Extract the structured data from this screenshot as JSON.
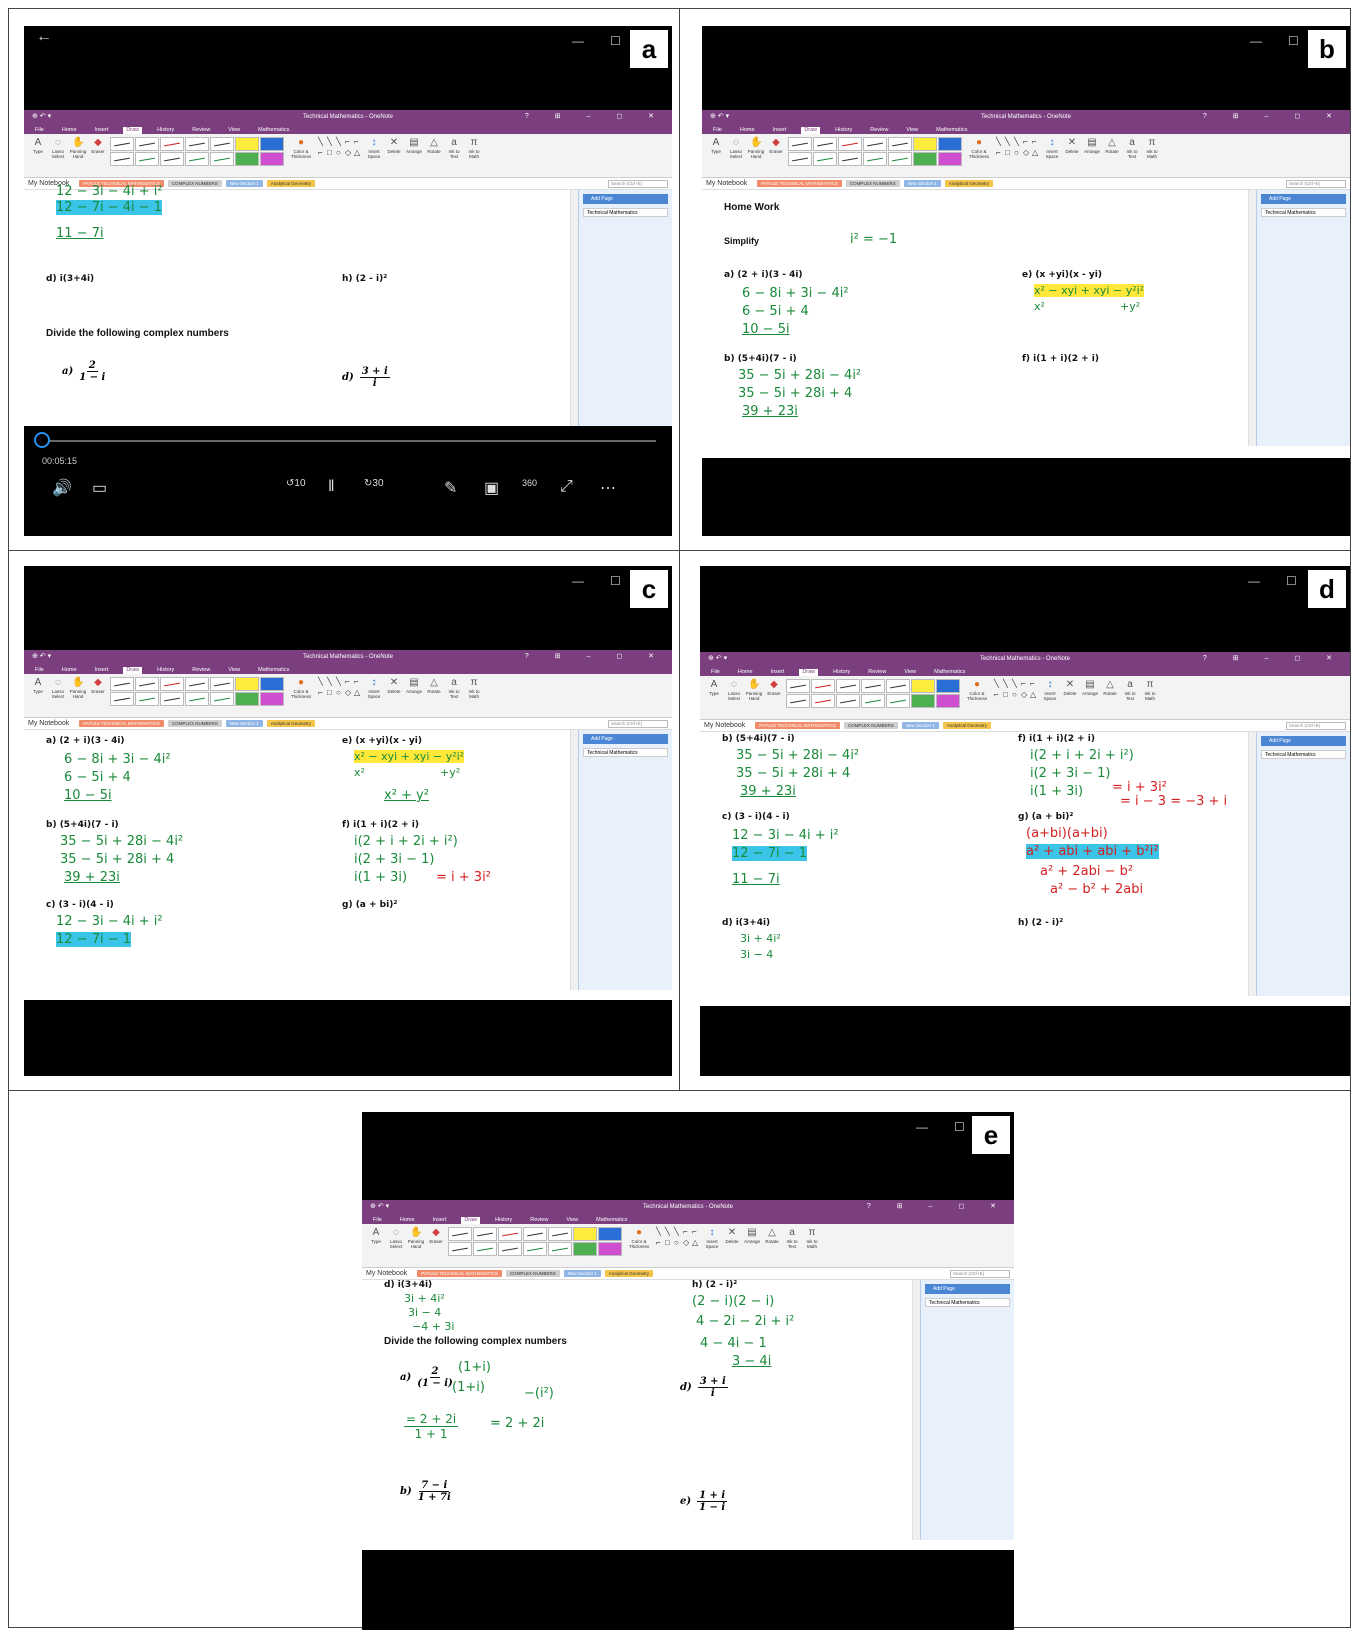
{
  "panels": [
    {
      "label": "a"
    },
    {
      "label": "b"
    },
    {
      "label": "c"
    },
    {
      "label": "d"
    },
    {
      "label": "e"
    }
  ],
  "app": {
    "title": "Technical Mathematics - OneNote",
    "menus": [
      "File",
      "Home",
      "Insert",
      "Draw",
      "History",
      "Review",
      "View",
      "Mathematics"
    ],
    "active_menu": "Draw",
    "ribbon_tools": [
      "Type",
      "Lasso Select",
      "Panning Hand",
      "Eraser"
    ],
    "ribbon_group_tools": "Tools",
    "ribbon_color": "Color & Thickness",
    "ribbon_group_shapes": "Shapes",
    "ribbon_edit": [
      "Insert Space",
      "Delete",
      "Arrange",
      "Rotate"
    ],
    "ribbon_group_edit": "Edit",
    "ribbon_convert": [
      "Ink to Text",
      "Ink to Math"
    ],
    "ribbon_group_convert": "Convert",
    "notebook": "My Notebook",
    "sections": [
      "PATULE TECHNICAL MATHEMATICS",
      "COMPLEX NUMBERS",
      "New Section 1",
      "Analytical Geometry"
    ],
    "search_placeholder": "Search (Ctrl+E)",
    "add_page": "Add Page",
    "page_name": "Technical Mathematics"
  },
  "video": {
    "time": "00:05:15",
    "skip_back": "10",
    "skip_fwd": "30",
    "vr": "360"
  },
  "a": {
    "ink1": "12 − 3i − 4i + i²",
    "ink2": "12 − 7i − 4i − 1",
    "ink3": "11 − 7i",
    "d": "d)  i(3+4i)",
    "h": "h)  (2 - i)²",
    "divide": "Divide the following complex numbers",
    "qa": "a)",
    "qa_num": "2",
    "qa_den": "1 − i",
    "qd": "d)",
    "qd_num": "3 + i",
    "qd_den": "i"
  },
  "b": {
    "title": "Home Work",
    "simplify": "Simplify",
    "i2": "i² = −1",
    "a": "a)  (2 + i)(3 - 4i)",
    "a1": "6 − 8i + 3i − 4i²",
    "a2": "6 − 5i + 4",
    "a3": "10 − 5i",
    "bq": "b)  (5+4i)(7 - i)",
    "b1": "35 − 5i + 28i − 4i²",
    "b2": "35 − 5i + 28i + 4",
    "b3": "39 + 23i",
    "e": "e)  (x +yi)(x - yi)",
    "e1": "x² − xyi + xyi − y²i²",
    "e2": "x²",
    "e3": "+y²",
    "f": "f)  i(1 + i)(2 + i)"
  },
  "c": {
    "a": "a)  (2 + i)(3 - 4i)",
    "a1": "6 − 8i + 3i − 4i²",
    "a2": "6 − 5i + 4",
    "a3": "10 − 5i",
    "bq": "b)  (5+4i)(7 - i)",
    "b1": "35 − 5i + 28i − 4i²",
    "b2": "35 − 5i + 28i + 4",
    "b3": "39 + 23i",
    "cq": "c)  (3 - i)(4 - i)",
    "c1": "12 − 3i − 4i + i²",
    "c2": "12 − 7i − 1",
    "e": "e)  (x +yi)(x - yi)",
    "e1": "x² − xyi + xyi − y²i²",
    "e2": "x²",
    "e3": "+y²",
    "e4": "x² + y²",
    "f": "f)  i(1 + i)(2 + i)",
    "f1": "i(2 + i + 2i + i²)",
    "f2": "i(2 + 3i − 1)",
    "f3": "i(1 + 3i)",
    "f4": "= i + 3i²",
    "g": "g)  (a + bi)²"
  },
  "d": {
    "bq": "b)  (5+4i)(7 - i)",
    "b1": "35 − 5i + 28i − 4i²",
    "b2": "35 − 5i + 28i + 4",
    "b3": "39 + 23i",
    "cq": "c)  (3 - i)(4 - i)",
    "c1": "12 − 3i − 4i + i²",
    "c2": "12 − 7i − 1",
    "c3": "11 − 7i",
    "dq": "d)  i(3+4i)",
    "d1": "3i + 4i²",
    "d2": "3i − 4",
    "f": "f)  i(1 + i)(2 + i)",
    "f1": "i(2 + i + 2i + i²)",
    "f2": "i(2 + 3i − 1)",
    "f3": "i(1 + 3i)",
    "f4": "= i + 3i²",
    "f5": "= i − 3 = −3 + i",
    "g": "g)  (a + bi)²",
    "g1": "(a+bi)(a+bi)",
    "g2": "a² + abi + abi + b²i²",
    "g3": "a² + 2abi − b²",
    "g4": "a² − b² + 2abi",
    "h": "h)  (2 - i)²"
  },
  "e": {
    "dq": "d)  i(3+4i)",
    "d1": "3i + 4i²",
    "d2": "3i − 4",
    "d3": "−4 + 3i",
    "divide": "Divide the following complex numbers",
    "qa": "a)",
    "qa_num": "2",
    "qa_den": "(1 − i)",
    "qa_mul": "(1+i)",
    "qa_mul2": "(1+i)",
    "qa_note": "−(i²)",
    "qa_step": "= 2 + 2i",
    "qa_step_den": "1 + 1",
    "qa_res": "= 2 + 2i",
    "qb": "b)",
    "qb_num": "7 − i",
    "qb_den": "1 + 7i",
    "h": "h)  (2 - i)²",
    "h1": "(2 − i)(2 − i)",
    "h2": "4 − 2i − 2i + i²",
    "h3": "4 − 4i − 1",
    "h4": "3 − 4i",
    "qd": "d)",
    "qd_num": "3 + i",
    "qd_den": "i",
    "qe": "e)",
    "qe_num": "1 + i",
    "qe_den": "1 − i"
  }
}
